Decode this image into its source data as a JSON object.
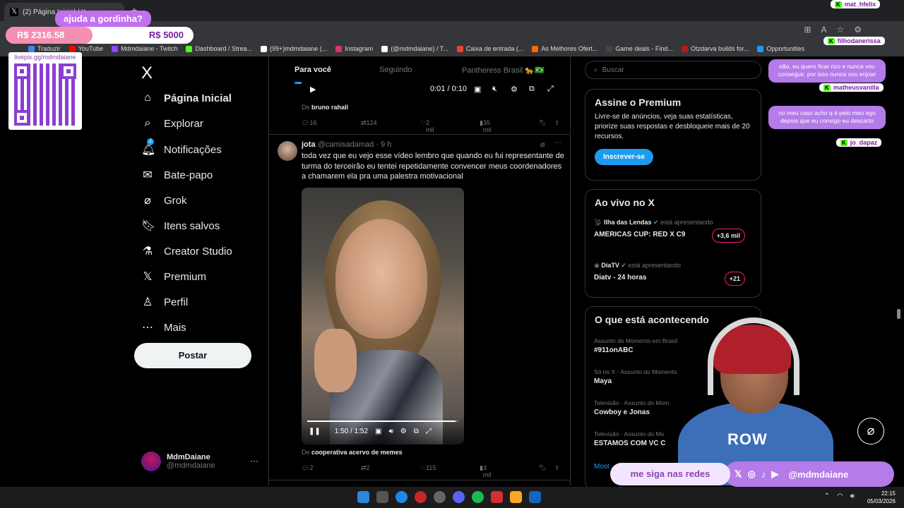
{
  "browser": {
    "tab_title": "(2) Página Inicial / X",
    "new_tab": "+",
    "bookmarks": [
      {
        "label": "Traduzir",
        "color": "#4285f4"
      },
      {
        "label": "YouTube",
        "color": "#ff0000"
      },
      {
        "label": "Mdmdaiane - Twitch",
        "color": "#9146ff"
      },
      {
        "label": "Dashboard / Strea...",
        "color": "#53fc18"
      },
      {
        "label": "(99+)mdmdaiane (...",
        "color": "#ffffff"
      },
      {
        "label": "Instagram",
        "color": "#e1306c"
      },
      {
        "label": "(@mdmdaiane) / T...",
        "color": "#ffffff"
      },
      {
        "label": "Caixa de entrada (...",
        "color": "#ea4335"
      },
      {
        "label": "As Melhores Ofert...",
        "color": "#ff6a00"
      },
      {
        "label": "Game deals - Find...",
        "color": "#444444"
      },
      {
        "label": "Otzdarva builds for...",
        "color": "#b71c1c"
      },
      {
        "label": "Opportunities",
        "color": "#1d9bf0"
      }
    ]
  },
  "overlay": {
    "donation_title": "ajuda a gordinha?",
    "donation_current": "R$ 2316.58",
    "donation_goal": "R$ 5000",
    "donation_progress": 0.463,
    "livepix_url": "livepix.gg/mdmdaiane",
    "chat": [
      {
        "user": "mat_hfelix",
        "message": ""
      },
      {
        "user": "filhodanerissa",
        "message": "não, eu quero ficar rico e nunca vou conseguir. por isso nunca vou enjoar"
      },
      {
        "user": "matheusvanilla",
        "message": "no meu caso acho q é pelo meu ego depois que eu consigo eu descarto"
      },
      {
        "user": "jo_dapaz",
        "message": ""
      }
    ],
    "social_left": "me siga nas redes",
    "social_handle": "@mdmdaiane",
    "cam_shirt_text": "ROW"
  },
  "nav": {
    "logo": "X",
    "items": [
      {
        "label": "Página Inicial",
        "icon": "home-icon"
      },
      {
        "label": "Explorar",
        "icon": "search-icon"
      },
      {
        "label": "Notificações",
        "icon": "bell-icon",
        "badge": "2"
      },
      {
        "label": "Bate-papo",
        "icon": "mail-icon"
      },
      {
        "label": "Grok",
        "icon": "grok-icon"
      },
      {
        "label": "Itens salvos",
        "icon": "bookmark-icon"
      },
      {
        "label": "Creator Studio",
        "icon": "flask-icon"
      },
      {
        "label": "Premium",
        "icon": "x-logo-icon"
      },
      {
        "label": "Perfil",
        "icon": "person-icon"
      },
      {
        "label": "Mais",
        "icon": "more-circle-icon"
      }
    ],
    "post_button": "Postar",
    "profile_name": "MdmDaiane",
    "profile_handle": "@mdmdaiane"
  },
  "timeline": {
    "tabs": [
      "Para você",
      "Seguindo",
      "Pantheress Brasil 🐆🇧🇷"
    ],
    "prev_post": {
      "time": "0:01 / 0:10",
      "from_prefix": "De",
      "from": "bruno rahall",
      "replies": "16",
      "reposts": "124",
      "likes": "2 mil",
      "views": "35 mil"
    },
    "post": {
      "name": "jota",
      "handle": "@camisadamad",
      "time": "· 9 h",
      "text": "toda vez que eu vejo esse vídeo lembro que quando eu fui representante de turma do terceirão eu tentei repetidamente convencer meus coordenadores a chamarem ela pra uma palestra motivacional",
      "video_time": "1:50 / 1:52",
      "video_progress": 0.98,
      "from_prefix": "De",
      "from": "cooperativa acervo de memes",
      "replies": "2",
      "reposts": "2",
      "likes": "115",
      "views": "3 mil"
    }
  },
  "sidebar": {
    "search_placeholder": "Buscar",
    "premium": {
      "title": "Assine o Premium",
      "text": "Livre-se de anúncios, veja suas estatísticas, priorize suas respostas e desbloqueie mais de 20 recursos.",
      "button": "Inscrever-se"
    },
    "live": {
      "title": "Ao vivo no X",
      "items": [
        {
          "host": "Ilha das Lendas",
          "status": "está apresentando",
          "title": "AMERICAS CUP: RED X C9",
          "count": "+3,6 mil"
        },
        {
          "host": "DiaTV",
          "status": "está apresentando",
          "title": "Diatv - 24 horas",
          "count": "+21"
        }
      ]
    },
    "trends": {
      "title": "O que está acontecendo",
      "items": [
        {
          "category": "Assunto do Momento em Brasil",
          "name": "#911onABC"
        },
        {
          "category": "Só no X · Assunto do Momento",
          "name": "Maya"
        },
        {
          "category": "Televisão · Assunto do Mom",
          "name": "Cowboy e Jonas"
        },
        {
          "category": "Televisão · Assunto do Mo",
          "name": "ESTAMOS COM VC C"
        }
      ],
      "show_more": "Most"
    }
  },
  "taskbar": {
    "time": "22:15",
    "date": "05/03/2026"
  }
}
